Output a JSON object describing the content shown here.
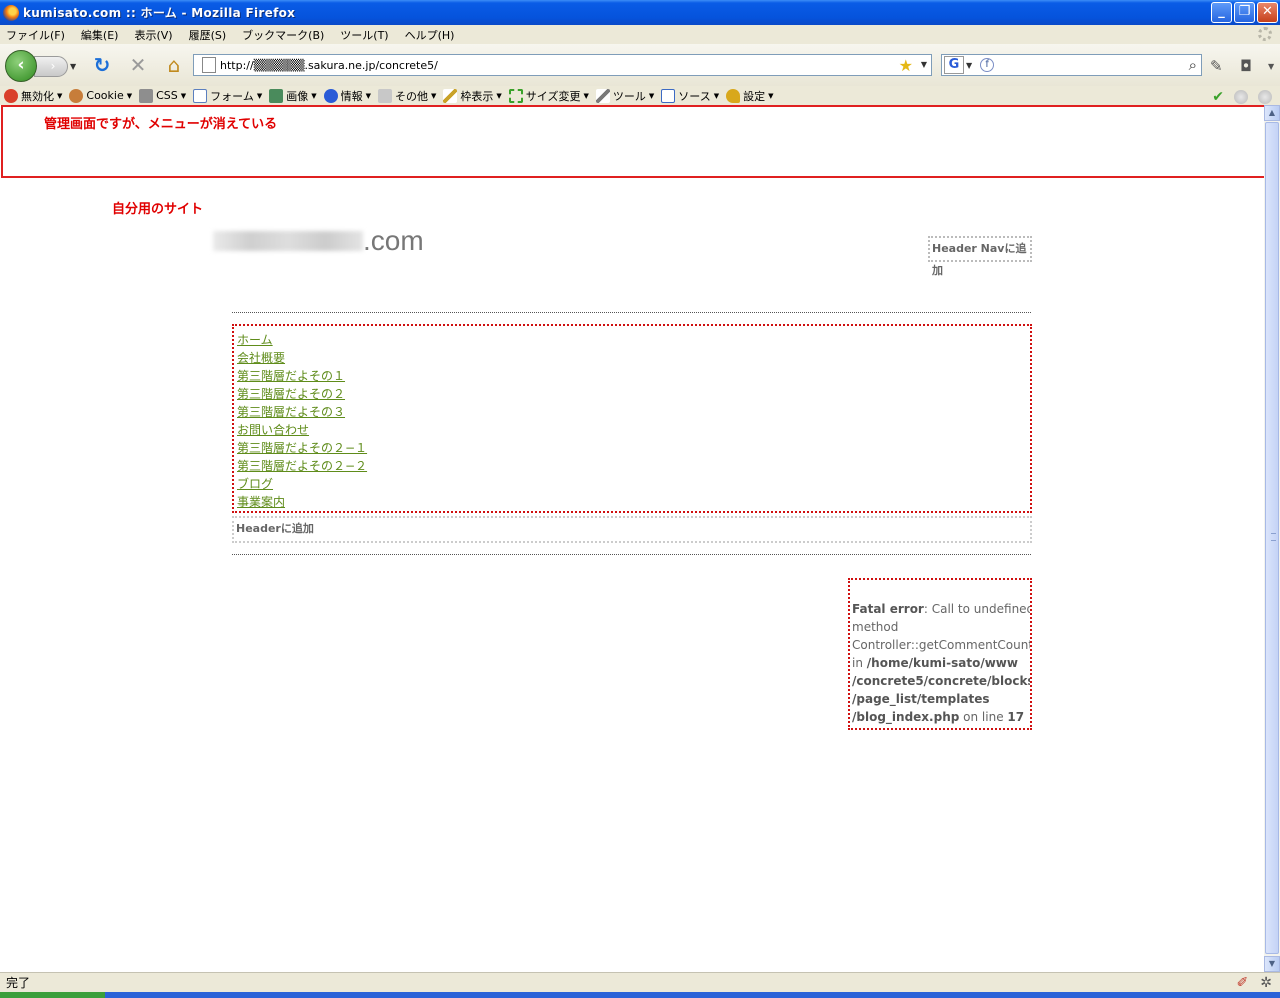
{
  "window": {
    "title": "kumisato.com :: ホーム - Mozilla Firefox",
    "buttons": [
      "_",
      "❐",
      "✕"
    ]
  },
  "menubar": {
    "items": [
      "ファイル(F)",
      "編集(E)",
      "表示(V)",
      "履歴(S)",
      "ブックマーク(B)",
      "ツール(T)",
      "ヘルプ(H)"
    ]
  },
  "navbar": {
    "url": "http://▒▒▒▒▒▒.sakura.ne.jp/concrete5/",
    "search_engine": "G",
    "search_value": ""
  },
  "webdev_toolbar": {
    "items": [
      {
        "label": "無効化",
        "icon": "disable-icon",
        "color": "#d9402b"
      },
      {
        "label": "Cookie",
        "icon": "cookie-icon",
        "color": "#c77d3a"
      },
      {
        "label": "CSS",
        "icon": "css-icon",
        "color": "#8e8e8e"
      },
      {
        "label": "フォーム",
        "icon": "form-icon",
        "color": "#5b7fbf"
      },
      {
        "label": "画像",
        "icon": "image-icon",
        "color": "#4a8b5c"
      },
      {
        "label": "情報",
        "icon": "info-icon",
        "color": "#2a5bd7"
      },
      {
        "label": "その他",
        "icon": "misc-icon",
        "color": "#a0a0a0"
      },
      {
        "label": "枠表示",
        "icon": "outline-icon",
        "color": "#c9a227"
      },
      {
        "label": "サイズ変更",
        "icon": "resize-icon",
        "color": "#3aa12a"
      },
      {
        "label": "ツール",
        "icon": "tools-icon",
        "color": "#7a7a7a"
      },
      {
        "label": "ソース",
        "icon": "source-icon",
        "color": "#3c6ac4"
      },
      {
        "label": "設定",
        "icon": "settings-icon",
        "color": "#d8a81c"
      }
    ]
  },
  "annotations": {
    "top_note": "管理画面ですが、メニューが消えている",
    "site_note": "自分用のサイト"
  },
  "site": {
    "domain_suffix": ".com",
    "header_nav_label": "Header Navに追加",
    "header_label": "Headerに追加",
    "nav_links": [
      "ホーム",
      "会社概要",
      "第三階層だよその１",
      "第三階層だよその２",
      "第三階層だよその３",
      "お問い合わせ",
      "第三階層だよその２−１",
      "第三階層だよその２−２",
      "ブログ",
      "事業案内"
    ],
    "error": {
      "label": "Fatal error",
      "lines": [
        "Call to undefined",
        "method",
        "Controller::getCommentCountString()",
        "in",
        "/home/kumi-sato/www",
        "/concrete5/concrete/blocks",
        "/page_list/templates",
        "/blog_index.php",
        "on line",
        "17"
      ]
    }
  },
  "statusbar": {
    "text": "完了"
  }
}
